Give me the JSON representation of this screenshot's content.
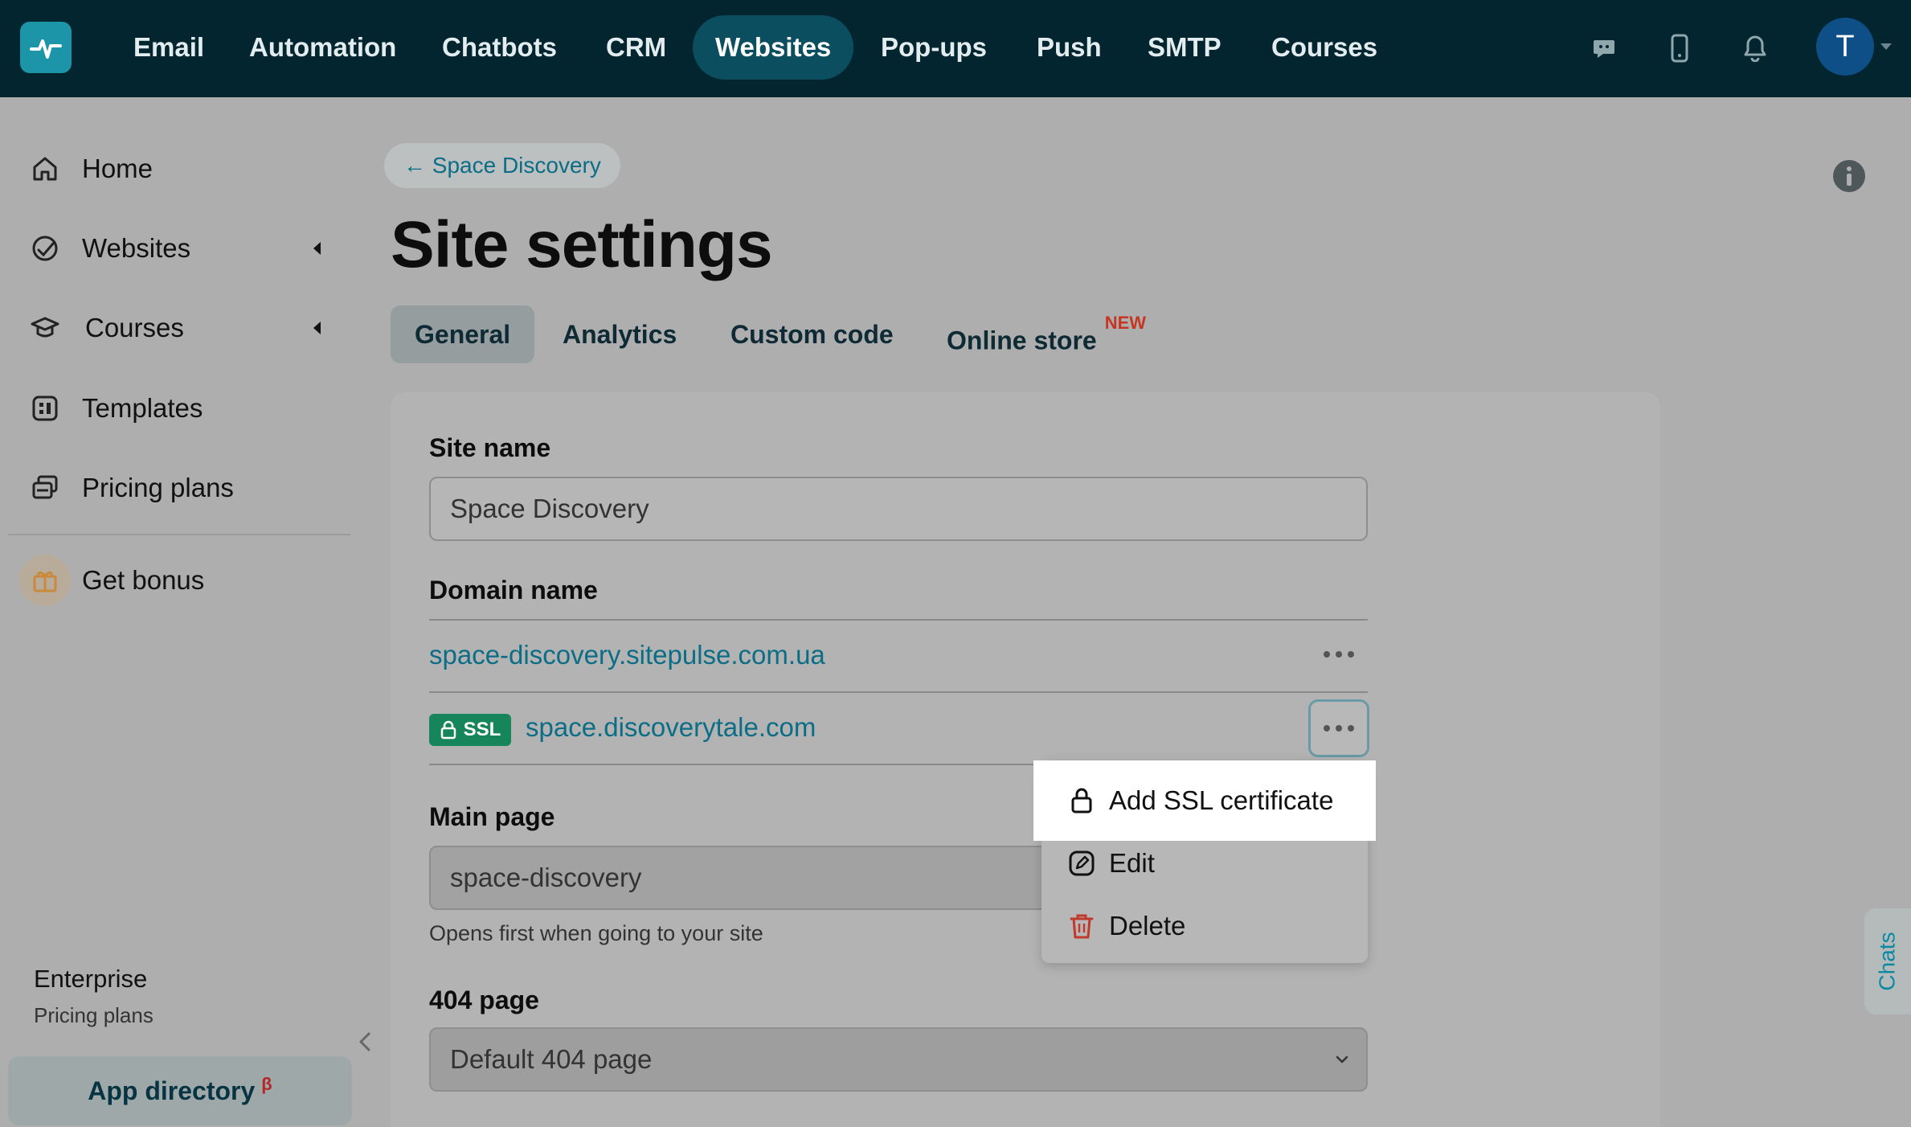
{
  "topnav": {
    "items": [
      {
        "label": "Email"
      },
      {
        "label": "Automation"
      },
      {
        "label": "Chatbots"
      },
      {
        "label": "CRM"
      },
      {
        "label": "Websites",
        "active": true
      },
      {
        "label": "Pop-ups"
      },
      {
        "label": "Push"
      },
      {
        "label": "SMTP"
      },
      {
        "label": "Courses"
      }
    ],
    "avatar_initial": "T",
    "icons": [
      "pulse-logo-icon",
      "chat-bubble-icon",
      "mobile-icon",
      "bell-icon"
    ]
  },
  "sidebar": {
    "items": [
      {
        "label": "Home",
        "icon": "home-icon"
      },
      {
        "label": "Websites",
        "icon": "websites-icon",
        "expandable": true
      },
      {
        "label": "Courses",
        "icon": "graduation-cap-icon",
        "expandable": true
      },
      {
        "label": "Templates",
        "icon": "templates-icon"
      },
      {
        "label": "Pricing plans",
        "icon": "pricing-plans-icon"
      }
    ],
    "bonus": {
      "label": "Get bonus",
      "icon": "gift-icon"
    },
    "plan": {
      "name": "Enterprise",
      "link": "Pricing plans"
    },
    "app_directory": {
      "label": "App directory",
      "badge": "β"
    }
  },
  "header": {
    "back_link": "← Space Discovery",
    "title": "Site settings"
  },
  "tabs": [
    {
      "label": "General",
      "active": true
    },
    {
      "label": "Analytics"
    },
    {
      "label": "Custom code"
    },
    {
      "label": "Online store",
      "badge": "NEW"
    }
  ],
  "form": {
    "site_name": {
      "label": "Site name",
      "value": "Space Discovery"
    },
    "domain": {
      "label": "Domain name",
      "entries": [
        {
          "url": "space-discovery.sitepulse.com.ua",
          "ssl": false
        },
        {
          "url": "space.discoverytale.com",
          "ssl": true,
          "ssl_label": "SSL"
        }
      ]
    },
    "main_page": {
      "label": "Main page",
      "value": "space-discovery",
      "hint": "Opens first when going to your site"
    },
    "page_404": {
      "label": "404 page",
      "value": "Default 404 page"
    }
  },
  "dropdown_menu": {
    "items": [
      {
        "label": "Add SSL certificate",
        "icon": "lock-icon",
        "highlighted": true
      },
      {
        "label": "Edit",
        "icon": "edit-icon"
      },
      {
        "label": "Delete",
        "icon": "trash-icon",
        "icon_color": "#c0392b"
      }
    ]
  },
  "chats_tab": {
    "label": "Chats"
  },
  "colors": {
    "topbar": "#022530",
    "accent": "#0b6d86",
    "ssl_green": "#17855b",
    "new_badge": "#c73622"
  }
}
